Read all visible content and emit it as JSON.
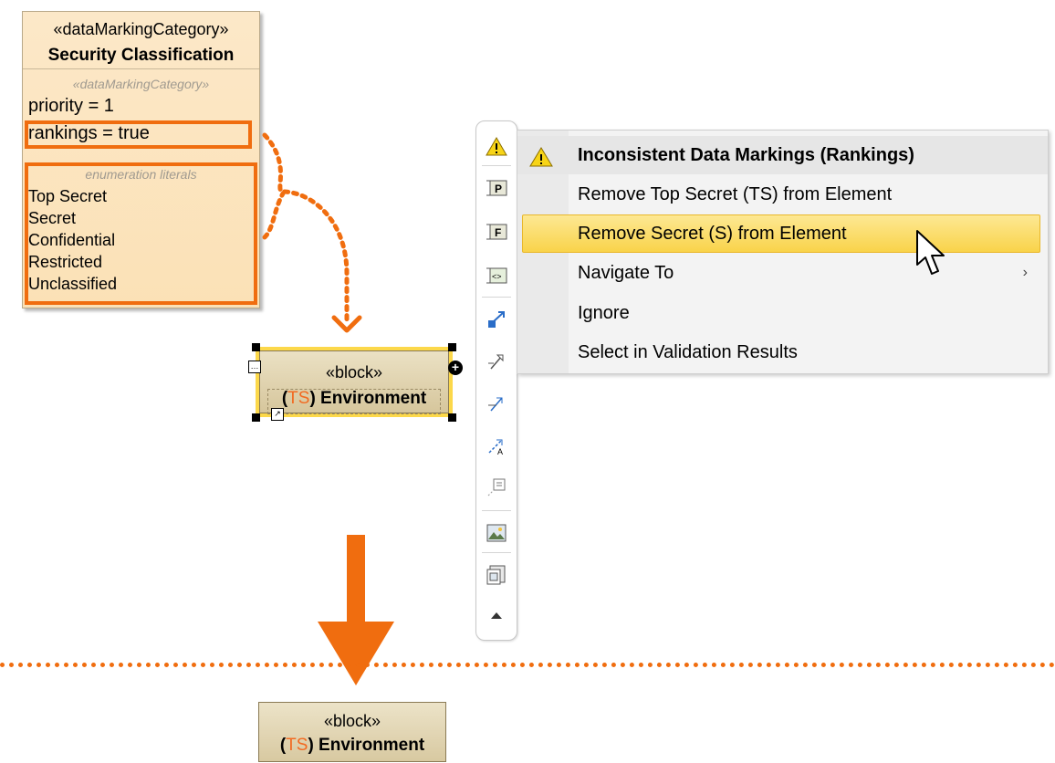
{
  "security_class": {
    "stereotype": "«dataMarkingCategory»",
    "name": "Security Classification",
    "compartment_stereotype": "«dataMarkingCategory»",
    "priority": "priority = 1",
    "rankings": "rankings = true",
    "literals_header": "enumeration literals",
    "literals": [
      "Top Secret",
      "Secret",
      "Confidential",
      "Restricted",
      "Unclassified"
    ]
  },
  "block_selected": {
    "stereotype": "«block»",
    "name_prefix_open": "(",
    "marking": "TS",
    "name_prefix_close": ")",
    "name": " Environment"
  },
  "block_result": {
    "stereotype": "«block»",
    "name_prefix_open": "(",
    "marking": "TS",
    "name_prefix_close": ")",
    "name": " Environment"
  },
  "context_menu": {
    "title": "Inconsistent Data Markings (Rankings)",
    "items": [
      {
        "label": "Remove Top Secret (TS) from Element"
      },
      {
        "label": "Remove Secret (S) from Element",
        "highlighted": true
      },
      {
        "label": "Navigate To",
        "submenu": true
      },
      {
        "label": "Ignore"
      },
      {
        "label": "Select in Validation Results"
      }
    ],
    "submenu_glyph": "›"
  },
  "toolbar": {
    "items": [
      "warning-icon",
      "part-property-icon",
      "flow-property-icon",
      "port-icon",
      "directed-association-icon",
      "generalization-icon",
      "dependency-icon",
      "anchor-icon",
      "note-icon",
      "image-icon",
      "diagram-icon",
      "collapse-icon"
    ]
  },
  "colors": {
    "accent": "#f06d0f",
    "highlight": "#f9d34a",
    "block_fill": "#d6c69c",
    "class_fill": "#fbe1b6",
    "marking_text": "#f26a21"
  }
}
